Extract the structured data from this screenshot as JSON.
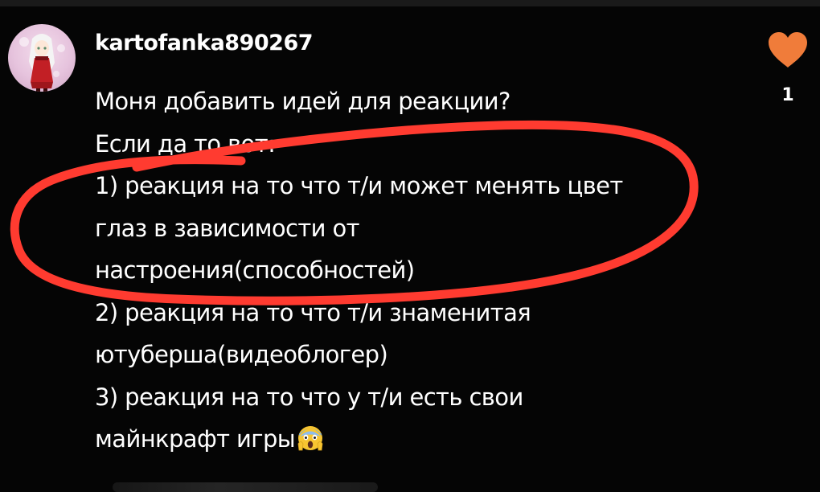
{
  "comment": {
    "username": "kartofanka890267",
    "lines": [
      "Моня добавить идей для реакции?",
      "Если да то вот:",
      "1) реакция на то что т/и может менять цвет",
      "глаз в зависимости от",
      "настроения(способностей)",
      "2) реакция на то что т/и знаменитая",
      "ютуберша(видеоблогер)",
      "3) реакция на то что у т/и есть свои",
      "майнкрафт игры"
    ],
    "emoji_icon": "screaming-face-icon",
    "avatar_icon": "anime-girl-avatar"
  },
  "likes": {
    "icon": "heart-icon",
    "count": "1",
    "heart_color": "#f07c3a"
  },
  "annotation": {
    "color": "#ff3b30"
  },
  "theme": {
    "background": "#050505",
    "text": "#ffffff"
  }
}
